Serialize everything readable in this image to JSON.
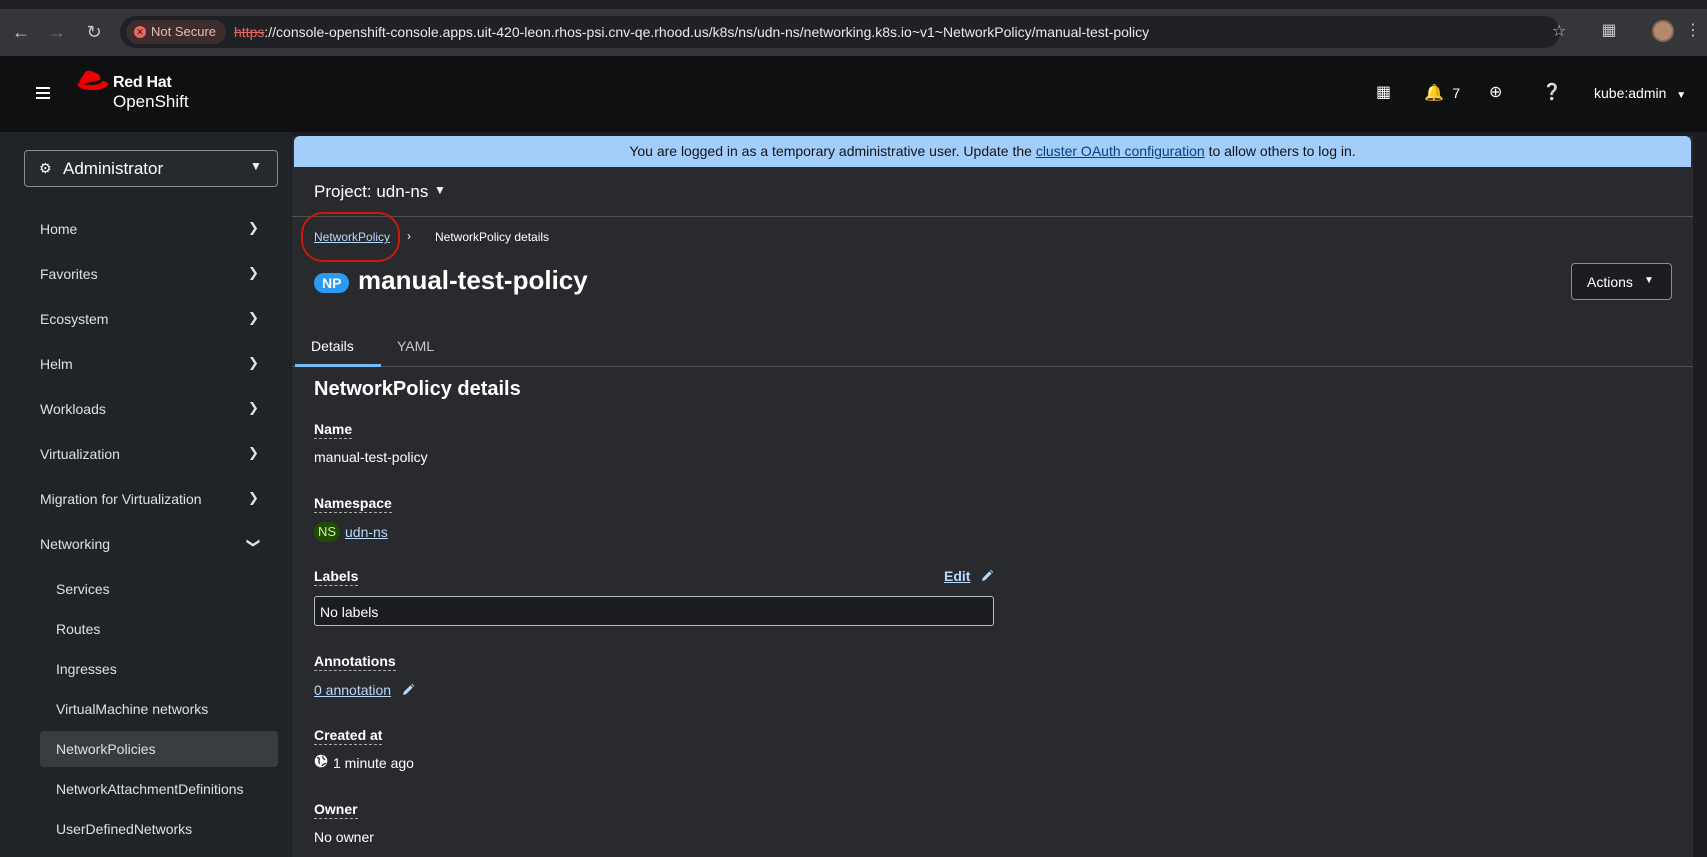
{
  "browser": {
    "security_label": "Not Secure",
    "url_scheme": "https",
    "url_rest": "://console-openshift-console.apps.uit-420-leon.rhos-psi.cnv-qe.rhood.us/k8s/ns/udn-ns/networking.k8s.io~v1~NetworkPolicy/manual-test-policy"
  },
  "masthead": {
    "logo_line1": "Red Hat",
    "logo_line2": "OpenShift",
    "notification_count": "7",
    "user": "kube:admin"
  },
  "sidebar": {
    "perspective": "Administrator",
    "items": [
      {
        "label": "Home"
      },
      {
        "label": "Favorites"
      },
      {
        "label": "Ecosystem"
      },
      {
        "label": "Helm"
      },
      {
        "label": "Workloads"
      },
      {
        "label": "Virtualization"
      },
      {
        "label": "Migration for Virtualization"
      },
      {
        "label": "Networking"
      }
    ],
    "networking_children": [
      {
        "label": "Services"
      },
      {
        "label": "Routes"
      },
      {
        "label": "Ingresses"
      },
      {
        "label": "VirtualMachine networks"
      },
      {
        "label": "NetworkPolicies"
      },
      {
        "label": "NetworkAttachmentDefinitions"
      },
      {
        "label": "UserDefinedNetworks"
      }
    ]
  },
  "banner": {
    "text_before": "You are logged in as a temporary administrative user. Update the ",
    "link": "cluster OAuth configuration",
    "text_after": " to allow others to log in."
  },
  "project": {
    "label": "Project: udn-ns"
  },
  "breadcrumb": {
    "parent": "NetworkPolicy",
    "current": "NetworkPolicy details"
  },
  "resource": {
    "badge": "NP",
    "name": "manual-test-policy",
    "actions_label": "Actions"
  },
  "tabs": [
    {
      "label": "Details"
    },
    {
      "label": "YAML"
    }
  ],
  "details": {
    "section_title": "NetworkPolicy details",
    "name_label": "Name",
    "name_value": "manual-test-policy",
    "namespace_label": "Namespace",
    "namespace_badge": "NS",
    "namespace_value": "udn-ns",
    "labels_label": "Labels",
    "labels_edit": "Edit",
    "labels_value": "No labels",
    "annotations_label": "Annotations",
    "annotations_value": "0 annotation",
    "created_label": "Created at",
    "created_value": "1 minute ago",
    "owner_label": "Owner",
    "owner_value": "No owner"
  }
}
